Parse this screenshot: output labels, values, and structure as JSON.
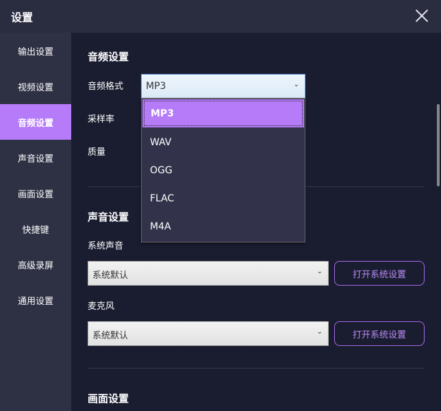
{
  "window": {
    "title": "设置"
  },
  "sidebar": {
    "items": [
      {
        "label": "输出设置"
      },
      {
        "label": "视频设置"
      },
      {
        "label": "音频设置"
      },
      {
        "label": "声音设置"
      },
      {
        "label": "画面设置"
      },
      {
        "label": "快捷键"
      },
      {
        "label": "高级录屏"
      },
      {
        "label": "通用设置"
      }
    ],
    "active_index": 2
  },
  "audio": {
    "title": "音频设置",
    "format_label": "音频格式",
    "format_value": "MP3",
    "format_options": [
      "MP3",
      "WAV",
      "OGG",
      "FLAC",
      "M4A"
    ],
    "sample_rate_label": "采样率",
    "quality_label": "质量"
  },
  "sound": {
    "title": "声音设置",
    "system_label": "系统声音",
    "system_value": "系统默认",
    "mic_label": "麦克风",
    "mic_value": "系统默认",
    "open_settings": "打开系统设置"
  },
  "screen": {
    "title": "画面设置"
  },
  "colors": {
    "accent": "#b57bf8",
    "sidebar": "#2e3044",
    "main": "#1a1d30"
  }
}
